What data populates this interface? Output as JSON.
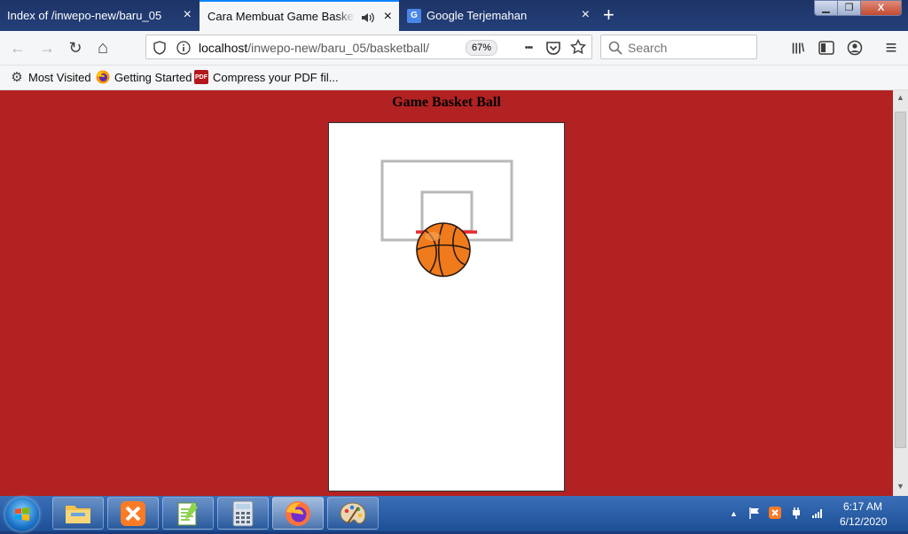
{
  "tabs": [
    {
      "title": "Index of /inwepo-new/baru_05",
      "active": false
    },
    {
      "title": "Cara Membuat Game Basketball",
      "active": true
    },
    {
      "title": "Google Terjemahan",
      "active": false
    }
  ],
  "icons": {
    "close_tab": "×",
    "new_tab": "+",
    "minimize": "▁",
    "maximize": "❐",
    "win_close": "X",
    "back": "←",
    "forward": "→",
    "reload": "↻",
    "home": "⌂",
    "more": "•••",
    "library": "|||\\",
    "sidebar": "▯",
    "account": "◉",
    "menu": "≡",
    "gear": "⚙",
    "favicon_google": "G",
    "favicon_pdf": "PDF",
    "scroll_up": "▲",
    "scroll_down": "▼"
  },
  "address_bar": {
    "url_host": "localhost",
    "url_path": "/inwepo-new/baru_05/basketball/",
    "zoom": "67%"
  },
  "search": {
    "placeholder": "Search"
  },
  "bookmarks": [
    {
      "label": "Most Visited",
      "icon": "gear-icon"
    },
    {
      "label": "Getting Started",
      "icon": "firefox-icon"
    },
    {
      "label": "Compress your PDF fil...",
      "icon": "pdf-icon"
    }
  ],
  "page": {
    "title": "Game Basket Ball",
    "background": "#b22222"
  },
  "taskbar": {
    "apps": [
      "file-explorer",
      "xampp",
      "notepad-plus-plus",
      "calculator",
      "firefox",
      "paint"
    ],
    "active_app": "firefox"
  },
  "clock": {
    "time": "6:17 AM",
    "date": "6/12/2020"
  }
}
